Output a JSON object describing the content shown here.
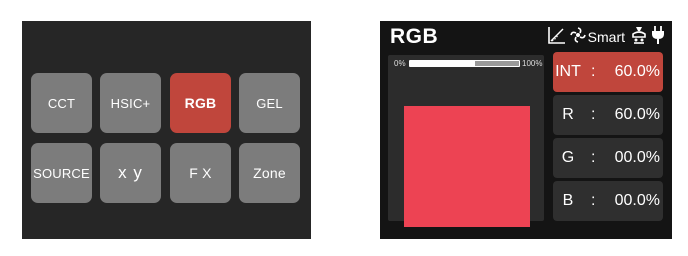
{
  "menu": {
    "buttons": [
      {
        "label": "CCT"
      },
      {
        "label": "HSIC+"
      },
      {
        "label": "RGB"
      },
      {
        "label": "GEL"
      },
      {
        "label": "SOURCE"
      },
      {
        "label": "x y"
      },
      {
        "label": "F X"
      },
      {
        "label": "Zone"
      }
    ],
    "active": "RGB"
  },
  "rgb_screen": {
    "title": "RGB",
    "status": {
      "icons": [
        "curve-icon",
        "fan-icon",
        "lamp-icon",
        "power-plug-icon"
      ],
      "fan_mode": "Smart"
    },
    "intensity_bar": {
      "min_label": "0%",
      "max_label": "100%",
      "level": 0.6
    },
    "preview_color": "#ed4353",
    "values": [
      {
        "label": "INT",
        "colon": ":",
        "value": "60.0%",
        "active": true
      },
      {
        "label": "R",
        "colon": ":",
        "value": "60.0%",
        "active": false
      },
      {
        "label": "G",
        "colon": ":",
        "value": "00.0%",
        "active": false
      },
      {
        "label": "B",
        "colon": ":",
        "value": "00.0%",
        "active": false
      }
    ]
  },
  "colors": {
    "accent": "#c0463c",
    "button": "#7c7c7c",
    "panel": "#262626",
    "screen": "#141414"
  }
}
